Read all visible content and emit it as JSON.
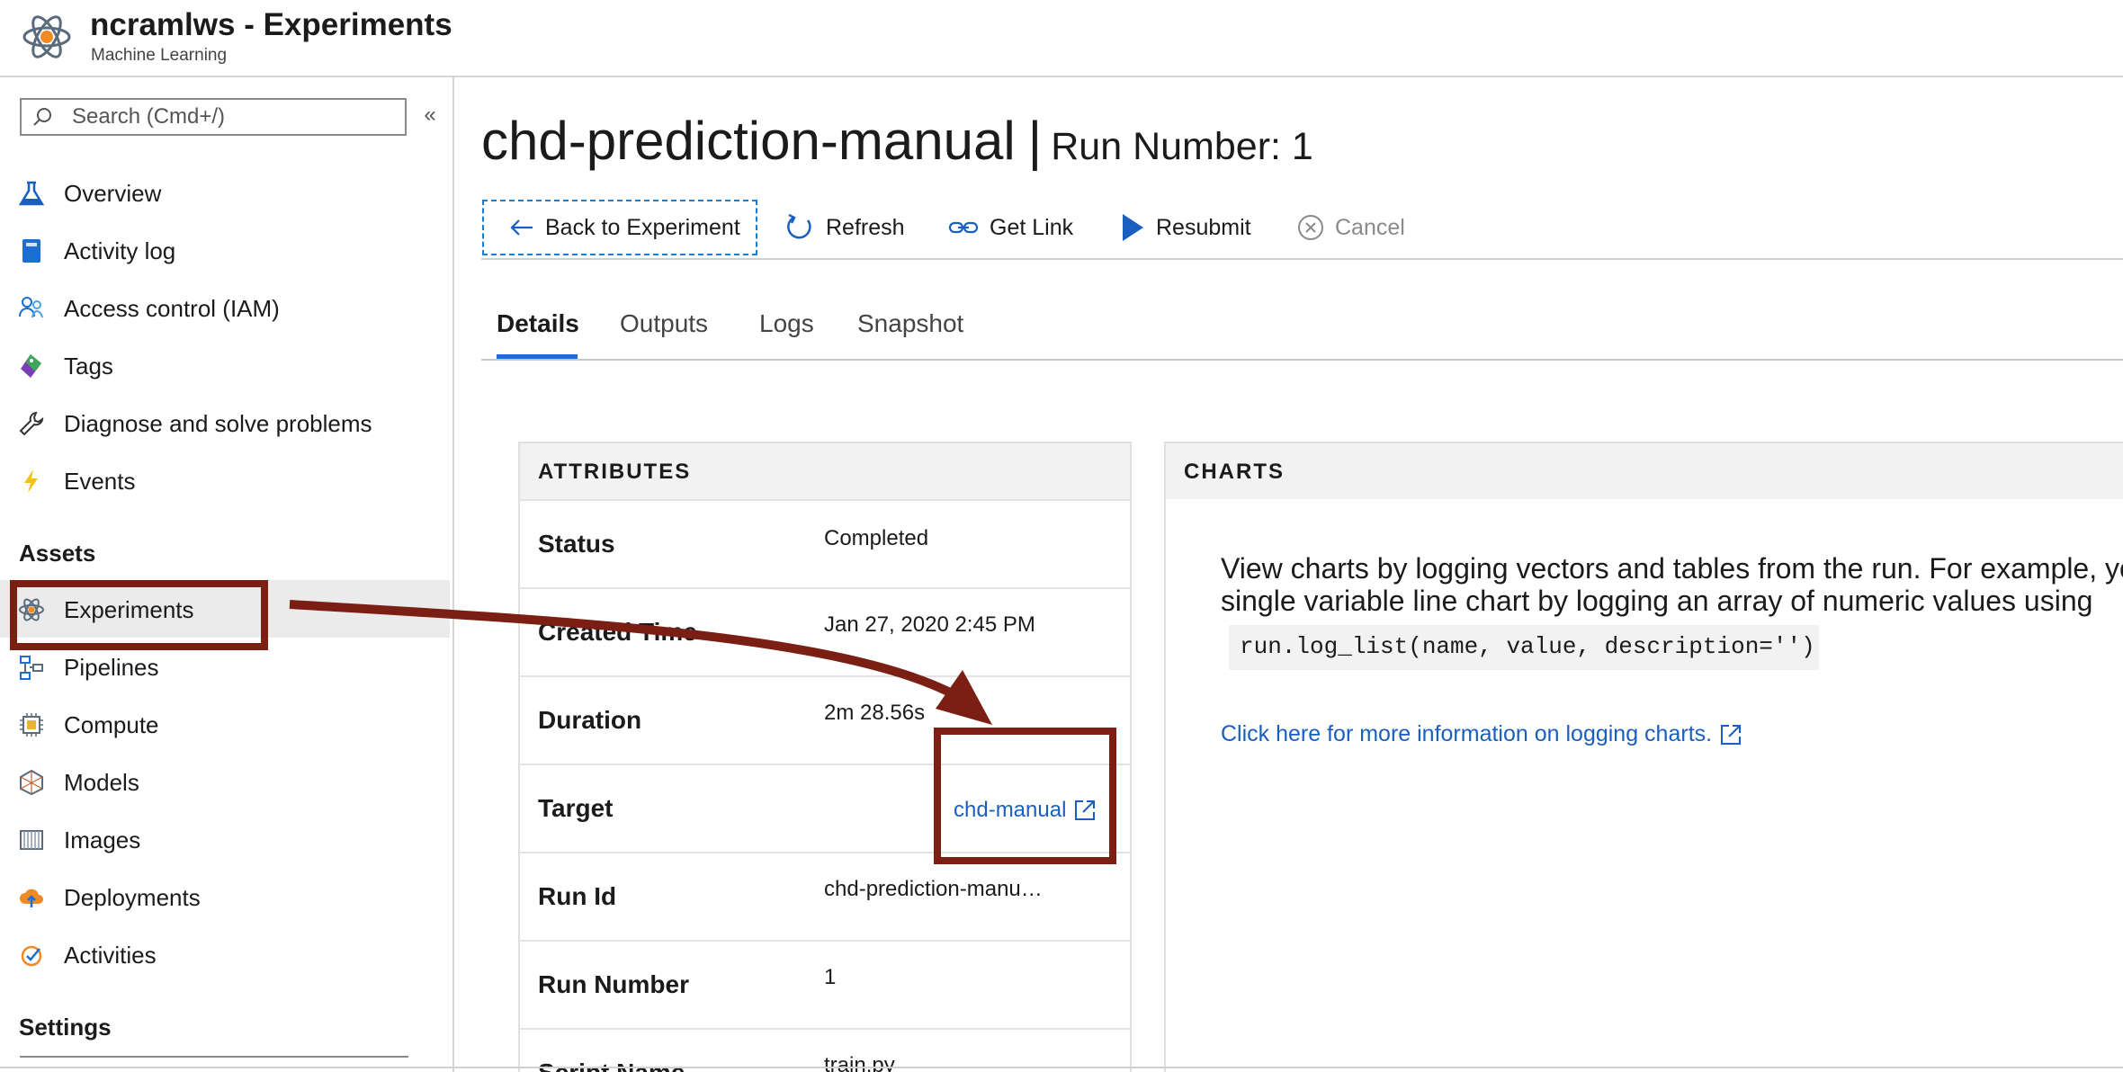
{
  "header": {
    "title": "ncramlws - Experiments",
    "subtitle": "Machine Learning",
    "logo_icon": "atom-icon"
  },
  "sidebar": {
    "search_placeholder": "Search (Cmd+/)",
    "collapse_glyph": "«",
    "items": [
      {
        "label": "Overview",
        "icon": "flask-icon"
      },
      {
        "label": "Activity log",
        "icon": "log-book-icon"
      },
      {
        "label": "Access control (IAM)",
        "icon": "people-icon"
      },
      {
        "label": "Tags",
        "icon": "tag-icon"
      },
      {
        "label": "Diagnose and solve problems",
        "icon": "wrench-icon"
      },
      {
        "label": "Events",
        "icon": "lightning-icon"
      }
    ],
    "assets_heading": "Assets",
    "assets": [
      {
        "label": "Experiments",
        "icon": "atom-icon",
        "selected": true
      },
      {
        "label": "Pipelines",
        "icon": "pipeline-icon"
      },
      {
        "label": "Compute",
        "icon": "chip-icon"
      },
      {
        "label": "Models",
        "icon": "model-icon"
      },
      {
        "label": "Images",
        "icon": "images-icon"
      },
      {
        "label": "Deployments",
        "icon": "cloud-upload-icon"
      },
      {
        "label": "Activities",
        "icon": "check-badge-icon"
      }
    ],
    "settings_heading": "Settings"
  },
  "main": {
    "title": "chd-prediction-manual",
    "title_separator": "|",
    "run_number_title": "Run Number: 1",
    "toolbar": {
      "back": "Back to Experiment",
      "refresh": "Refresh",
      "get_link": "Get Link",
      "resubmit": "Resubmit",
      "cancel": "Cancel"
    },
    "tabs": [
      {
        "label": "Details",
        "active": true
      },
      {
        "label": "Outputs"
      },
      {
        "label": "Logs"
      },
      {
        "label": "Snapshot"
      }
    ],
    "attributes": {
      "heading": "ATTRIBUTES",
      "rows": [
        {
          "key": "Status",
          "value": "Completed"
        },
        {
          "key": "Created Time",
          "value": "Jan 27, 2020 2:45 PM"
        },
        {
          "key": "Duration",
          "value": "2m 28.56s"
        },
        {
          "key": "Target",
          "value": "chd-manual"
        },
        {
          "key": "Run Id",
          "value": "chd-prediction-manu…"
        },
        {
          "key": "Run Number",
          "value": "1"
        },
        {
          "key": "Script Name",
          "value": "train.py"
        }
      ]
    },
    "charts": {
      "heading": "CHARTS",
      "line1": "View charts by logging vectors and tables from the run. For example, yo",
      "line2": "single variable line chart by logging an array of numeric values using",
      "code": "run.log_list(name, value, description='')",
      "link": "Click here for more information on logging charts."
    }
  },
  "colors": {
    "annotation": "#7b1e13",
    "link": "#1a5fc0",
    "tab_underline": "#1a6fd1",
    "selected_bg": "#ebebeb"
  }
}
